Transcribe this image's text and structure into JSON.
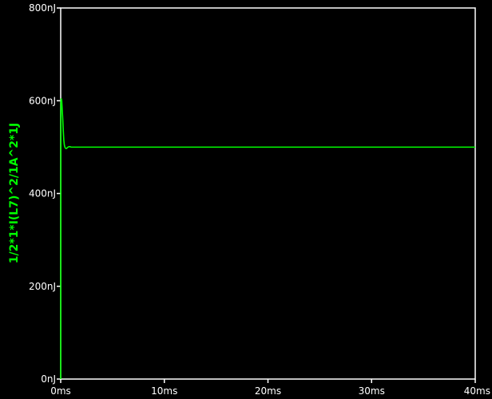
{
  "chart_data": {
    "type": "line",
    "title": "",
    "xlabel": "",
    "ylabel": "1/2*1*I(L7)^2/1A^2*1J",
    "xlim": [
      0,
      40
    ],
    "ylim": [
      0,
      800
    ],
    "x_unit": "ms",
    "y_unit": "nJ",
    "x_ticks": [
      0,
      10,
      20,
      30,
      40
    ],
    "x_tick_labels": [
      "0ms",
      "10ms",
      "20ms",
      "30ms",
      "40ms"
    ],
    "y_ticks": [
      0,
      200,
      400,
      600,
      800
    ],
    "y_tick_labels": [
      "0nJ",
      "200nJ",
      "400nJ",
      "600nJ",
      "800nJ"
    ],
    "grid": false,
    "colors": {
      "background": "#000000",
      "axes": "#ffffff",
      "trace": "#00ff00"
    },
    "series": [
      {
        "x": [
          0,
          0.02,
          0.05,
          0.1,
          0.15,
          0.2,
          0.25,
          0.3,
          0.35,
          0.4,
          0.45,
          0.5,
          0.55,
          0.6,
          0.7,
          0.8,
          0.9,
          1.0,
          1.2,
          1.5,
          2,
          5,
          10,
          20,
          30,
          40
        ],
        "values": [
          0,
          600,
          605,
          600,
          580,
          560,
          535,
          515,
          505,
          500,
          498,
          497,
          497,
          498,
          500,
          501,
          501,
          500,
          500,
          500,
          500,
          500,
          500,
          500,
          500,
          500
        ]
      }
    ]
  }
}
